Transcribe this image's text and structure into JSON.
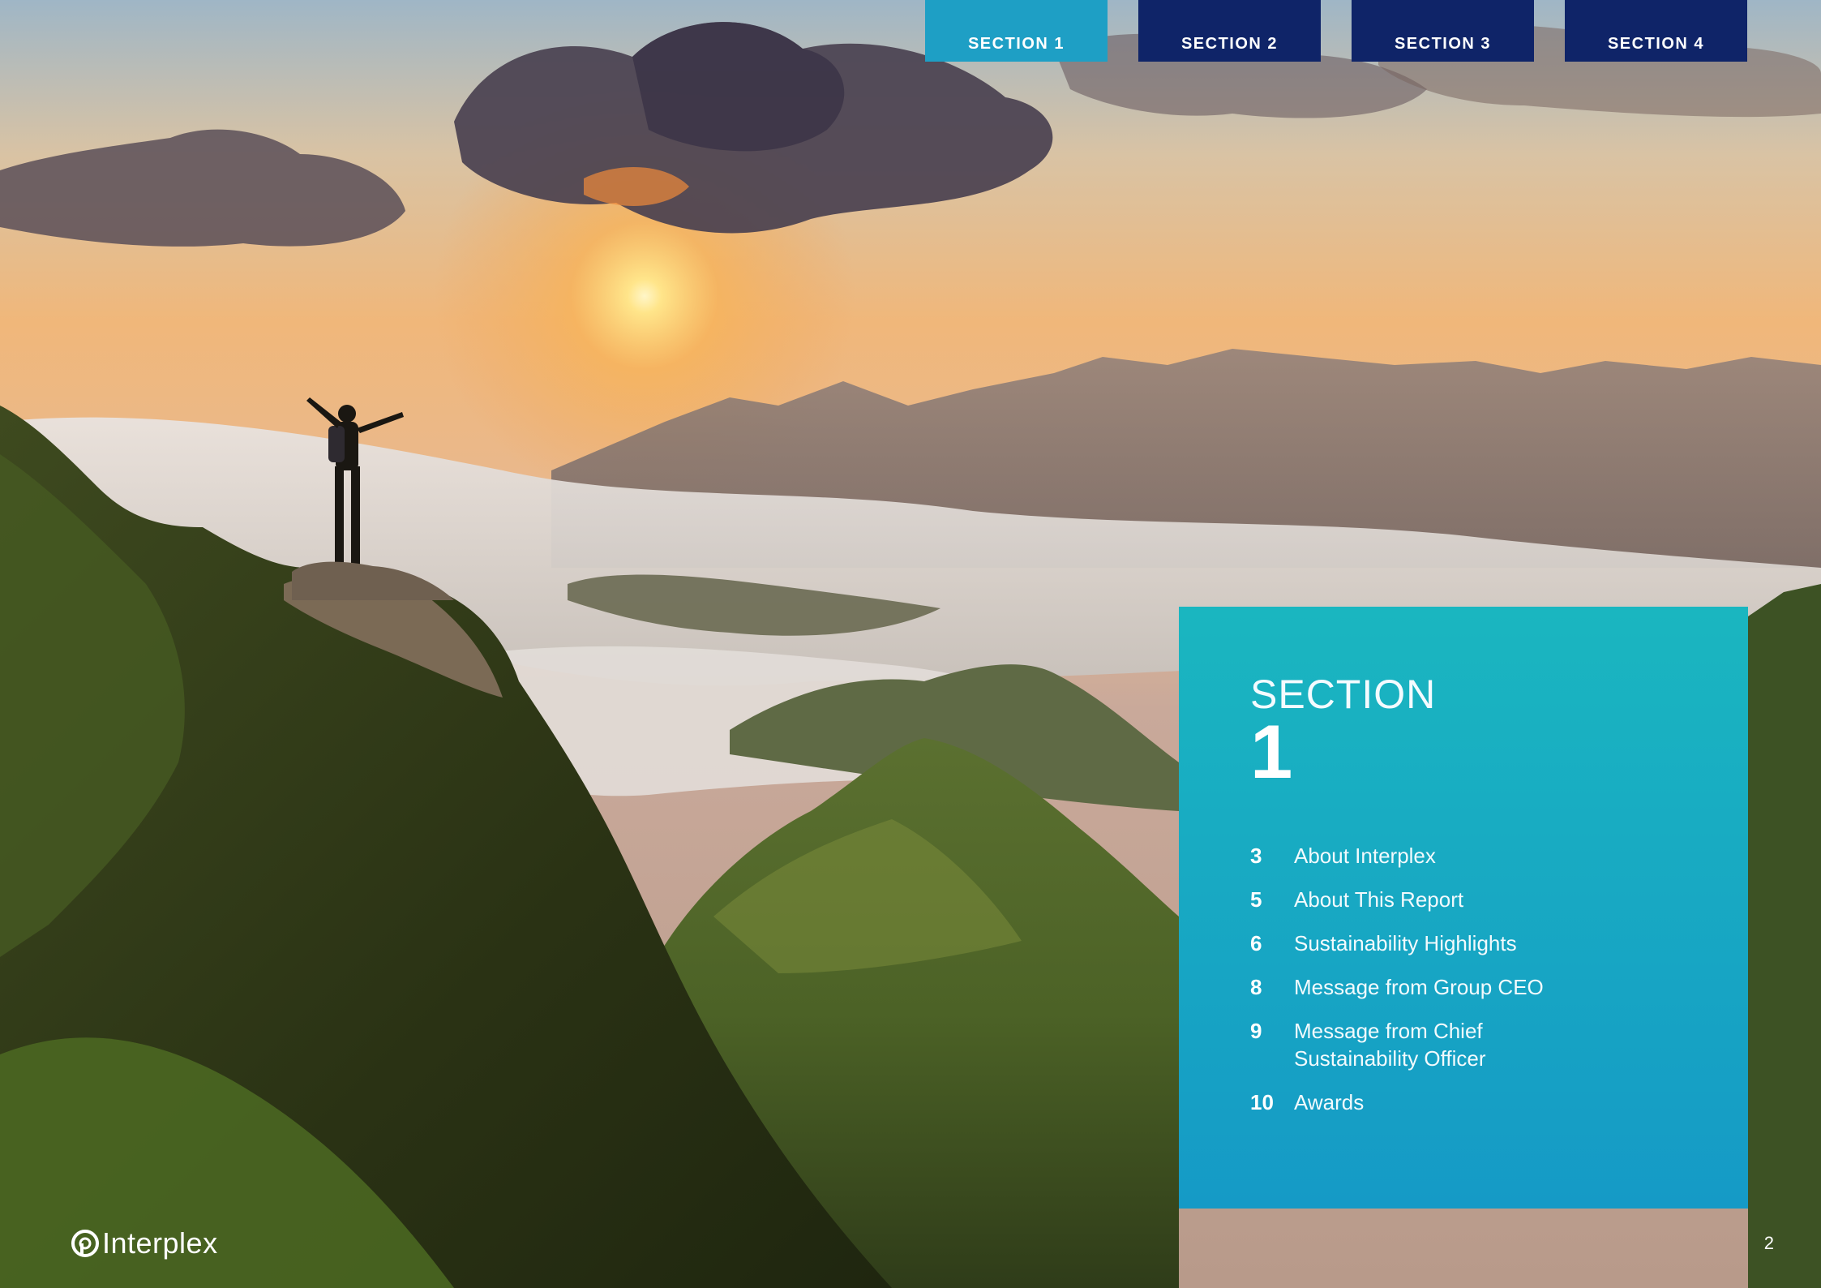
{
  "nav": {
    "tabs": [
      {
        "label": "SECTION 1",
        "active": true
      },
      {
        "label": "SECTION 2",
        "active": false
      },
      {
        "label": "SECTION 3",
        "active": false
      },
      {
        "label": "SECTION 4",
        "active": false
      }
    ]
  },
  "panel": {
    "section_word": "SECTION",
    "section_number": "1",
    "toc": [
      {
        "page": "3",
        "title": "About Interplex"
      },
      {
        "page": "5",
        "title": "About This Report"
      },
      {
        "page": "6",
        "title": "Sustainability Highlights"
      },
      {
        "page": "8",
        "title": "Message from Group CEO"
      },
      {
        "page": "9",
        "title": "Message from Chief Sustainability Officer"
      },
      {
        "page": "10",
        "title": "Awards"
      }
    ]
  },
  "footer": {
    "logo_text": "Interplex",
    "page_number": "2"
  },
  "colors": {
    "active_tab": "#1e9fc5",
    "inactive_tab": "#0f2468",
    "panel_top": "#1ab6c0",
    "panel_bottom": "#159ac6"
  }
}
